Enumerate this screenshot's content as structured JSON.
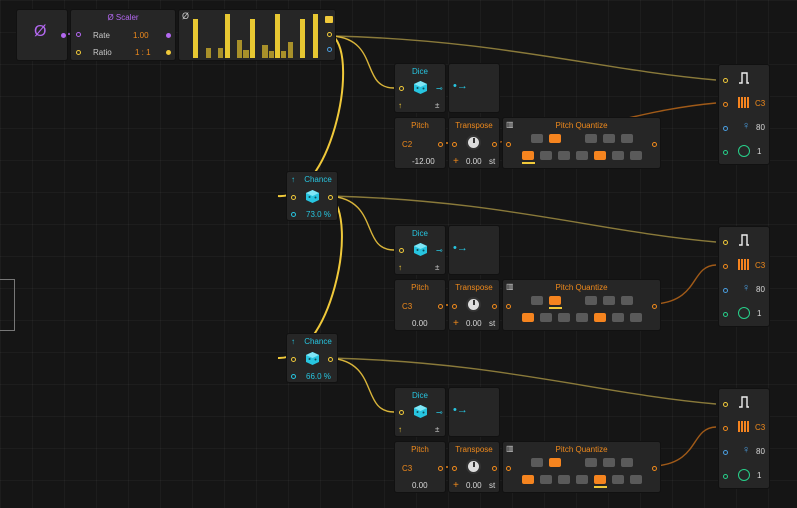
{
  "colors": {
    "orange": "#f08a1c",
    "cyan": "#27c5e0",
    "yellow": "#f0c93a",
    "purple": "#b368f0",
    "blue": "#4a9ee0"
  },
  "scaler": {
    "title": "Ø Scaler",
    "rate_label": "Rate",
    "rate_value": "1.00",
    "ratio_label": "Ratio",
    "ratio_value": "1 : 1"
  },
  "phase_icon": "Ø",
  "pattern": {
    "icon": "Ø",
    "steps": [
      0.86,
      0.0,
      0.22,
      0.0,
      0.22,
      0.98,
      0.0,
      0.4,
      0.18,
      0.86,
      0.0,
      0.3,
      0.16,
      0.98,
      0.16,
      0.36,
      0.0,
      0.86,
      0.0,
      0.98
    ]
  },
  "chance": [
    {
      "title": "Chance",
      "value": "73.0 %"
    },
    {
      "title": "Chance",
      "value": "66.0 %"
    }
  ],
  "rows": [
    {
      "dice_title": "Dice",
      "dice_pm": "±",
      "pitch_title": "Pitch",
      "pitch_note": "C2",
      "pitch_value": "-12.00",
      "transpose_title": "Transpose",
      "transpose_value": "0.00",
      "transpose_unit": "st",
      "transpose_plus": "+",
      "pq_title": "Pitch Quantize",
      "pq_black": [
        false,
        true,
        false,
        false,
        false
      ],
      "pq_white": [
        true,
        false,
        false,
        false,
        true,
        false,
        false
      ],
      "pq_white_marker": 0,
      "pq_black_marker": -1,
      "out_note": "C3",
      "out_velocity": "80",
      "out_third": "1"
    },
    {
      "dice_title": "Dice",
      "dice_pm": "±",
      "pitch_title": "Pitch",
      "pitch_note": "C3",
      "pitch_value": "0.00",
      "transpose_title": "Transpose",
      "transpose_value": "0.00",
      "transpose_unit": "st",
      "transpose_plus": "+",
      "pq_title": "Pitch Quantize",
      "pq_black": [
        false,
        true,
        false,
        false,
        false
      ],
      "pq_white": [
        true,
        false,
        false,
        false,
        true,
        false,
        false
      ],
      "pq_white_marker": -1,
      "pq_black_marker": 1,
      "out_note": "C3",
      "out_velocity": "80",
      "out_third": "1"
    },
    {
      "dice_title": "Dice",
      "dice_pm": "±",
      "pitch_title": "Pitch",
      "pitch_note": "C3",
      "pitch_value": "0.00",
      "transpose_title": "Transpose",
      "transpose_value": "0.00",
      "transpose_unit": "st",
      "transpose_plus": "+",
      "pq_title": "Pitch Quantize",
      "pq_black": [
        false,
        true,
        false,
        false,
        false
      ],
      "pq_white": [
        true,
        false,
        false,
        false,
        true,
        false,
        false
      ],
      "pq_white_marker": 4,
      "pq_black_marker": -1,
      "out_note": "C3",
      "out_velocity": "80",
      "out_third": "1"
    }
  ]
}
